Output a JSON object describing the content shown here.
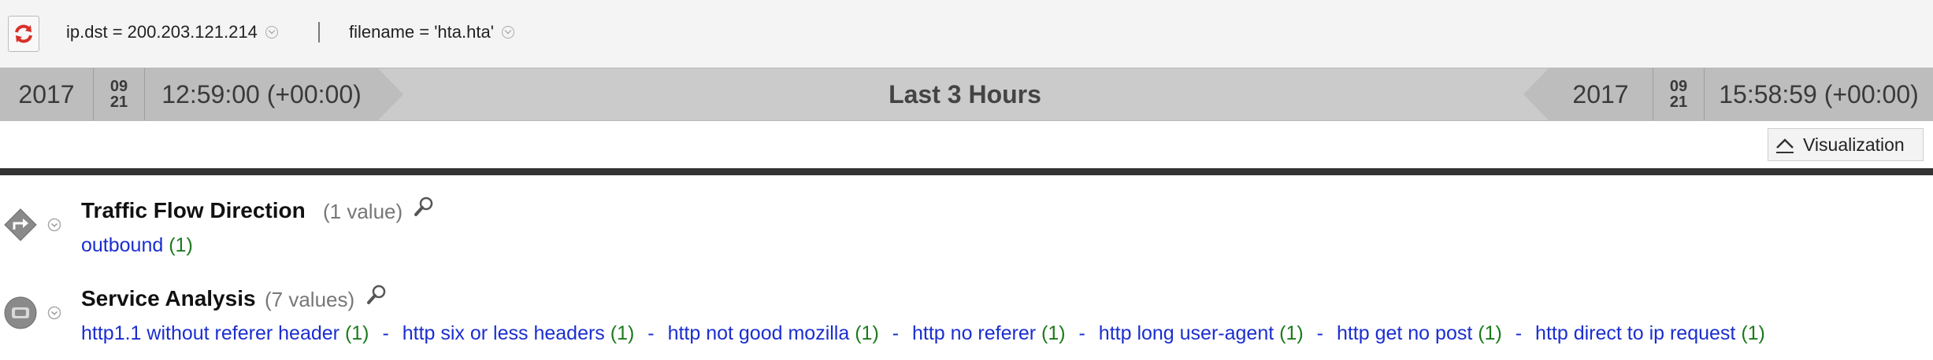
{
  "query": {
    "filters": [
      {
        "text": "ip.dst = 200.203.121.214"
      },
      {
        "text": "filename = 'hta.hta'"
      }
    ]
  },
  "timeline": {
    "start": {
      "year": "2017",
      "month": "09",
      "day": "21",
      "time": "12:59:00 (+00:00)"
    },
    "range_label": "Last 3 Hours",
    "end": {
      "year": "2017",
      "month": "09",
      "day": "21",
      "time": "15:58:59 (+00:00)"
    }
  },
  "visualization_button": {
    "label": "Visualization"
  },
  "sections": [
    {
      "title": "Traffic Flow Direction",
      "count": "(1 value)",
      "icon": "traffic-flow-diamond-icon",
      "values": [
        {
          "label": "outbound",
          "count": "(1)"
        }
      ]
    },
    {
      "title": "Service Analysis",
      "count": "(7 values)",
      "icon": "service-analysis-icon",
      "values": [
        {
          "label": "http1.1 without referer header",
          "count": "(1)"
        },
        {
          "label": "http six or less headers",
          "count": "(1)"
        },
        {
          "label": "http not good mozilla",
          "count": "(1)"
        },
        {
          "label": "http no referer",
          "count": "(1)"
        },
        {
          "label": "http long user-agent",
          "count": "(1)"
        },
        {
          "label": "http get no post",
          "count": "(1)"
        },
        {
          "label": "http direct to ip request",
          "count": "(1)"
        }
      ],
      "separator": "-"
    }
  ],
  "colors": {
    "link": "#1b2ed0",
    "count": "#1c7a1c",
    "timeline_bg": "#cbcbcb",
    "timeline_seg": "#bdbdbd",
    "refresh_red": "#d9302a"
  }
}
